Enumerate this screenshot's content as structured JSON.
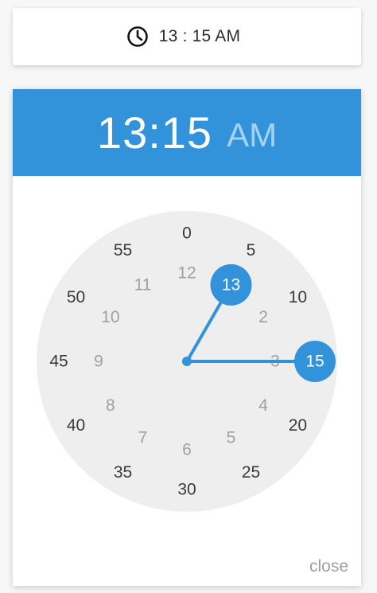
{
  "time_field": {
    "icon": "clock-icon",
    "value": "13 : 15 AM"
  },
  "picker": {
    "header": {
      "time": "13:15",
      "ampm": "AM"
    },
    "dial": {
      "minute_labels": [
        "0",
        "5",
        "10",
        "15",
        "20",
        "25",
        "30",
        "35",
        "40",
        "45",
        "50",
        "55"
      ],
      "hour_labels": [
        "12",
        "1",
        "2",
        "3",
        "4",
        "5",
        "6",
        "7",
        "8",
        "9",
        "10",
        "11"
      ],
      "selected_hour": "13",
      "selected_minute": "15",
      "colors": {
        "accent": "#3293db",
        "face": "#eeeeee",
        "minute_text": "#3a3a3a",
        "hour_text": "#a0a0a0"
      }
    },
    "close_label": "close"
  }
}
